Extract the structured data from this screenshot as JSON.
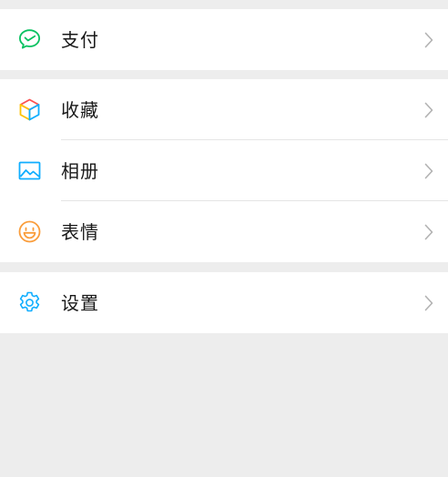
{
  "theme": {
    "background": "#ededed",
    "card": "#ffffff",
    "text": "#191919",
    "divider": "#e5e5e5",
    "chevron": "#b2b2b2"
  },
  "menu": {
    "pay": {
      "label": "支付",
      "icon": "pay-icon",
      "icon_color": "#07c160"
    },
    "favorites": {
      "label": "收藏",
      "icon": "favorites-cube-icon",
      "icon_colors": [
        "#fa5151",
        "#ffc300",
        "#10aeff"
      ]
    },
    "album": {
      "label": "相册",
      "icon": "album-icon",
      "icon_color": "#10aeff"
    },
    "emoji": {
      "label": "表情",
      "icon": "emoji-icon",
      "icon_color": "#fa9d3b"
    },
    "settings": {
      "label": "设置",
      "icon": "settings-gear-icon",
      "icon_color": "#10aeff"
    }
  },
  "chevron_icon": "chevron-right-icon"
}
